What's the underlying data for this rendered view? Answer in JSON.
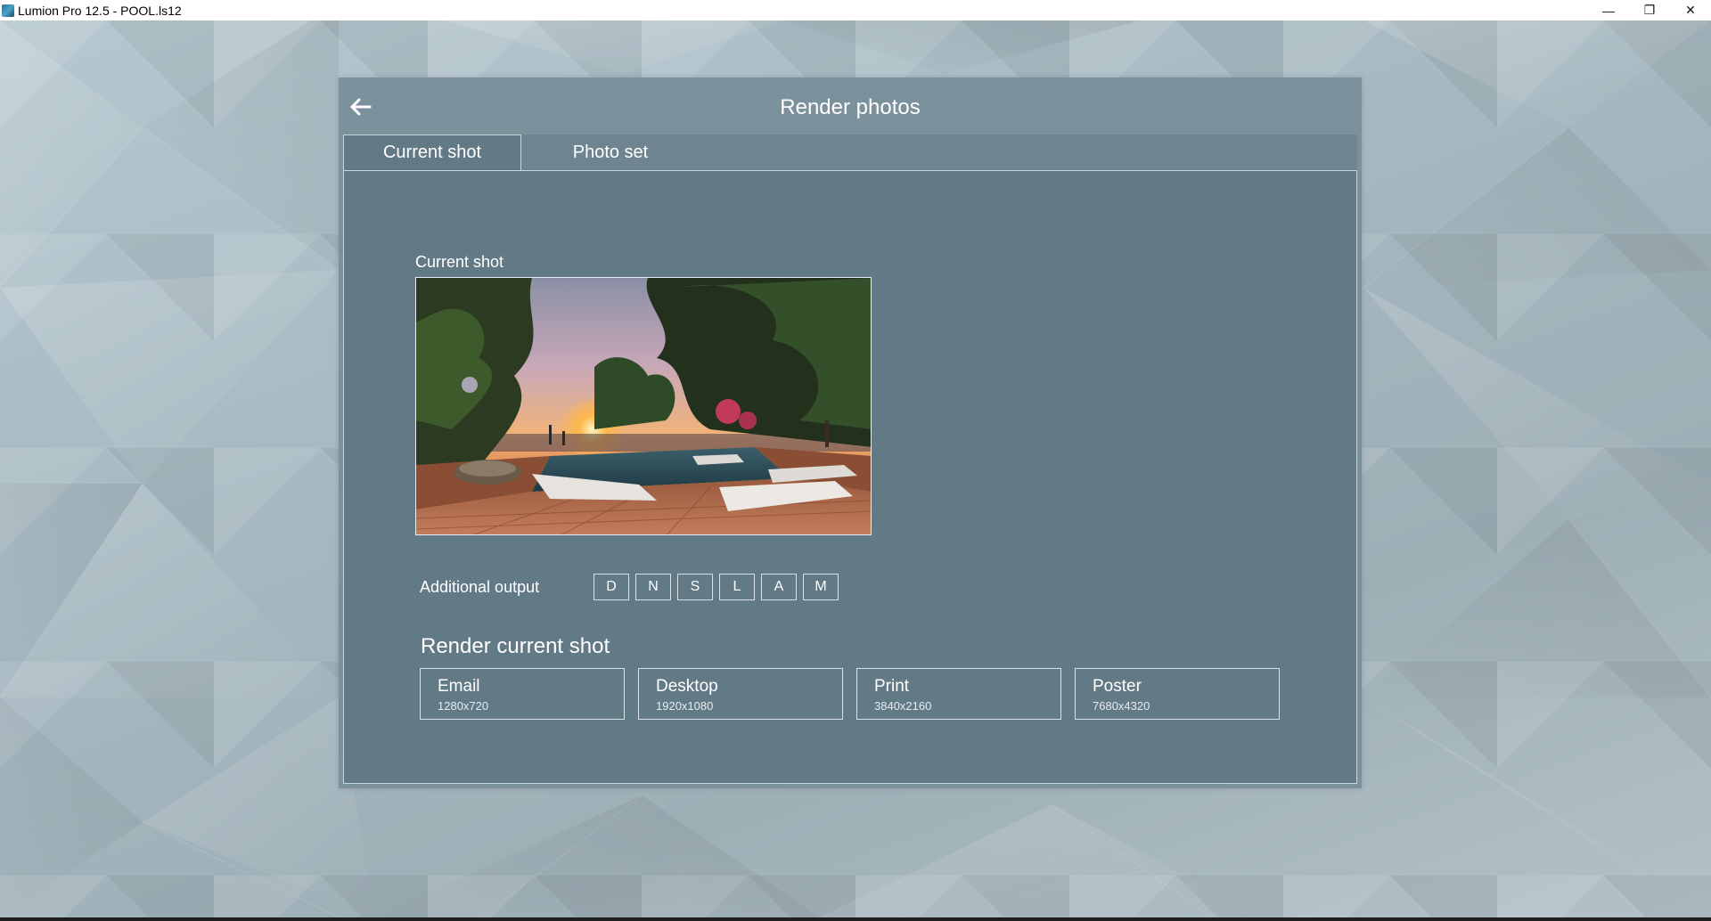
{
  "window": {
    "title": "Lumion Pro 12.5 - POOL.ls12",
    "minimize": "—",
    "restore": "❐",
    "close": "✕"
  },
  "dialog": {
    "title": "Render photos",
    "tabs": [
      {
        "label": "Current shot",
        "active": true
      },
      {
        "label": "Photo set",
        "active": false
      }
    ],
    "preview_label": "Current shot",
    "additional_output": {
      "label": "Additional output",
      "buttons": [
        "D",
        "N",
        "S",
        "L",
        "A",
        "M"
      ]
    },
    "render_heading": "Render current shot",
    "resolutions": [
      {
        "name": "Email",
        "size": "1280x720"
      },
      {
        "name": "Desktop",
        "size": "1920x1080"
      },
      {
        "name": "Print",
        "size": "3840x2160"
      },
      {
        "name": "Poster",
        "size": "7680x4320"
      }
    ]
  }
}
